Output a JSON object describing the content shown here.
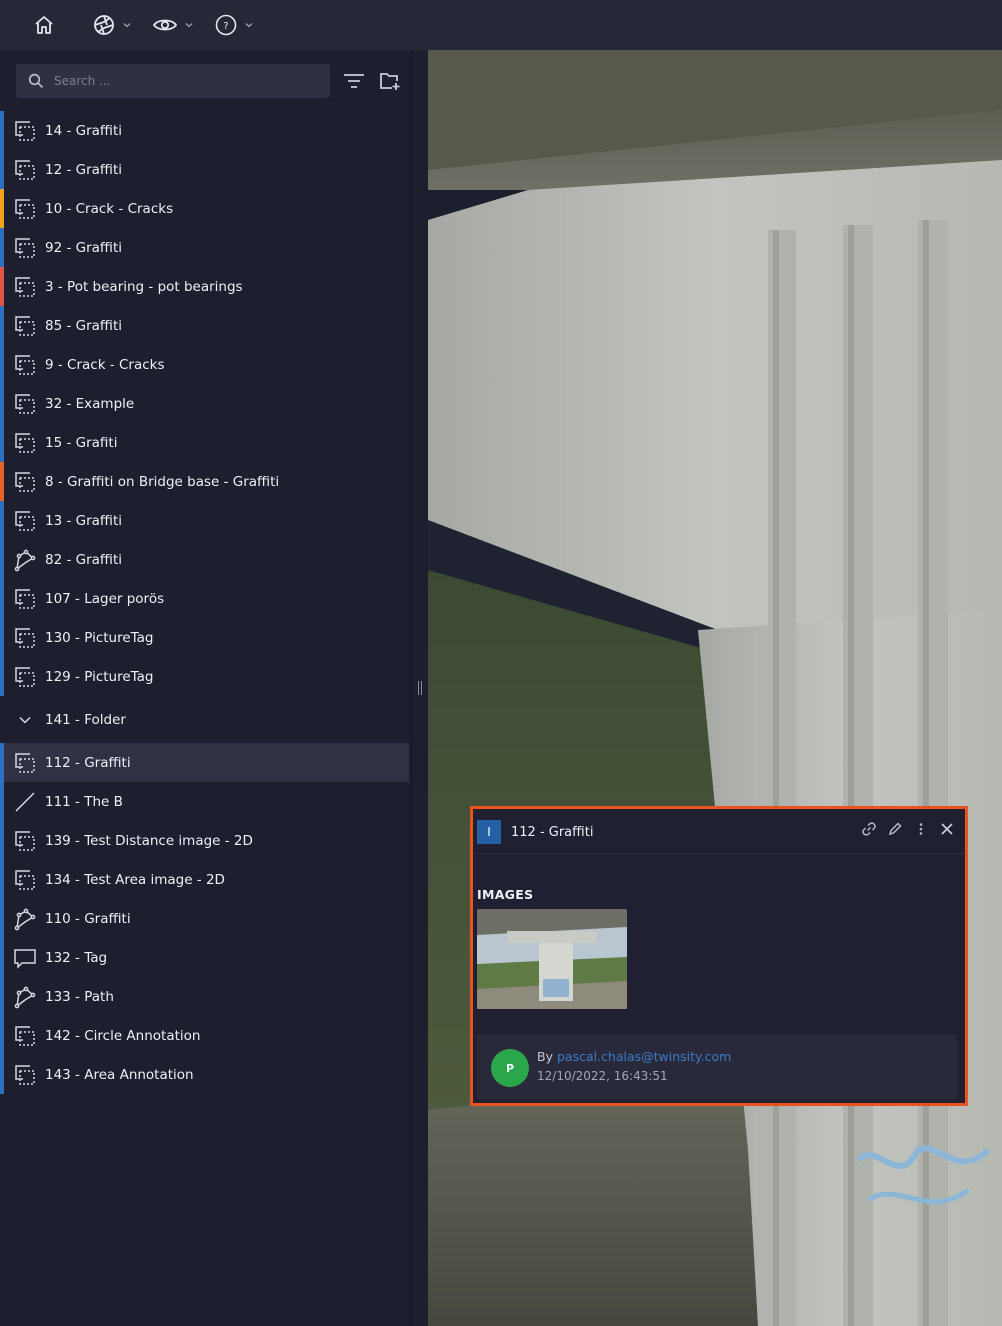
{
  "topbar": {
    "icons": [
      "home-icon",
      "aperture-icon",
      "eye-icon",
      "help-icon"
    ]
  },
  "sidebar": {
    "search_placeholder": "Search ...",
    "items": [
      {
        "label": "14 - Graffiti",
        "icon": "area-icon",
        "bar": "#2e6fc0"
      },
      {
        "label": "12 - Graffiti",
        "icon": "area-icon",
        "bar": "#2e6fc0"
      },
      {
        "label": "10 - Crack - Cracks",
        "icon": "area-icon",
        "bar": "#f0a21b"
      },
      {
        "label": "92 - Graffiti",
        "icon": "area-icon",
        "bar": "#2e6fc0"
      },
      {
        "label": "3 - Pot bearing - pot bearings",
        "icon": "area-icon",
        "bar": "#e0544a"
      },
      {
        "label": "85 - Graffiti",
        "icon": "area-icon",
        "bar": "#2e6fc0"
      },
      {
        "label": "9 - Crack - Cracks",
        "icon": "area-icon",
        "bar": "#2e6fc0"
      },
      {
        "label": "32 - Example",
        "icon": "area-icon",
        "bar": "#2e6fc0"
      },
      {
        "label": "15 - Grafiti",
        "icon": "area-icon",
        "bar": "#2e6fc0"
      },
      {
        "label": "8 - Graffiti on Bridge base - Graffiti",
        "icon": "area-icon",
        "bar": "#e8622a"
      },
      {
        "label": "13 - Graffiti",
        "icon": "area-icon",
        "bar": "#2e6fc0"
      },
      {
        "label": "82 - Graffiti",
        "icon": "polygon-icon",
        "bar": "#2e6fc0"
      },
      {
        "label": "107 - Lager porös",
        "icon": "area-icon",
        "bar": "#2e6fc0"
      },
      {
        "label": "130 - PictureTag",
        "icon": "area-icon",
        "bar": "#2e6fc0"
      },
      {
        "label": "129 - PictureTag",
        "icon": "area-icon",
        "bar": "#2e6fc0"
      }
    ],
    "folder": {
      "label": "141 - Folder",
      "icon": "chevron-down-icon"
    },
    "folder_items": [
      {
        "label": "112 - Graffiti",
        "icon": "area-icon",
        "bar": "#2e6fc0",
        "selected": true
      },
      {
        "label": "111 - The B",
        "icon": "line-icon",
        "bar": "#2e6fc0"
      },
      {
        "label": "139 - Test Distance image - 2D",
        "icon": "area-icon",
        "bar": "#2e6fc0"
      },
      {
        "label": "134 - Test Area image - 2D",
        "icon": "area-icon",
        "bar": "#2e6fc0"
      },
      {
        "label": "110 - Graffiti",
        "icon": "polygon-icon",
        "bar": "#2e6fc0"
      },
      {
        "label": "132 - Tag",
        "icon": "tag-icon",
        "bar": "#2e6fc0"
      },
      {
        "label": "133 - Path",
        "icon": "polygon-icon",
        "bar": "#2e6fc0"
      },
      {
        "label": "142 - Circle Annotation",
        "icon": "area-icon",
        "bar": "#2e6fc0"
      },
      {
        "label": "143 - Area Annotation",
        "icon": "area-icon",
        "bar": "#2e6fc0"
      }
    ]
  },
  "panel": {
    "badge": "I",
    "title": "112 - Graffiti",
    "images_label": "IMAGES",
    "comment": {
      "avatar": "P",
      "by_prefix": "By",
      "author": "pascal.chalas@twinsity.com",
      "timestamp": "12/10/2022, 16:43:51"
    }
  },
  "colors": {
    "accent": "#2e6fc0",
    "highlight": "#e8531f"
  }
}
